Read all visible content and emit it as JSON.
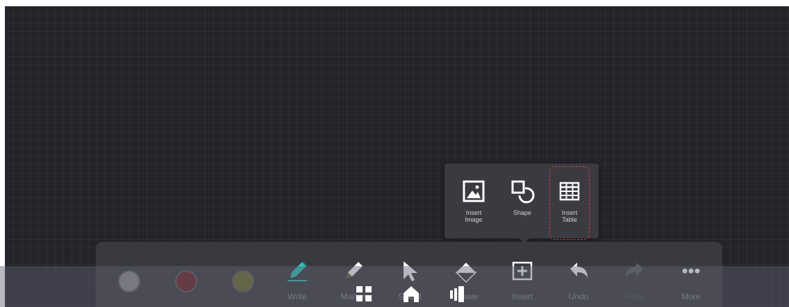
{
  "popup": {
    "items": [
      {
        "label": "Insert\nImage",
        "icon": "insert-image-icon"
      },
      {
        "label": "Shape",
        "icon": "shape-icon"
      },
      {
        "label": "Insert\nTable",
        "icon": "insert-table-icon"
      }
    ],
    "highlighted": "Insert Table",
    "highlight_color": "#d9363e"
  },
  "toolbar": {
    "colors": [
      "#8a8a8e",
      "#6b1e22",
      "#6a6a28"
    ],
    "tools": [
      {
        "label": "Write",
        "icon": "pen-icon"
      },
      {
        "label": "Marker",
        "icon": "marker-icon"
      },
      {
        "label": "Select",
        "icon": "pointer-icon"
      },
      {
        "label": "Eraser",
        "icon": "eraser-icon"
      },
      {
        "label": "Insert",
        "icon": "insert-icon"
      },
      {
        "label": "Undo",
        "icon": "undo-icon"
      },
      {
        "label": "Redo",
        "icon": "redo-icon"
      },
      {
        "label": "More",
        "icon": "more-icon"
      }
    ],
    "accent_color": "#2ec4b6"
  },
  "navbar": {
    "buttons": [
      {
        "icon": "apps-grid-icon"
      },
      {
        "icon": "home-icon"
      },
      {
        "icon": "window-switch-icon"
      }
    ]
  }
}
